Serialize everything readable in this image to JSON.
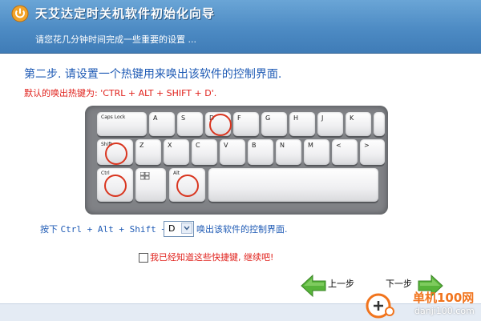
{
  "window": {
    "title": "天艾达定时关机软件初始化向导",
    "subtitle": "请您花几分钟时间完成一些重要的设置 ..."
  },
  "step": {
    "text": "第二步. 请设置一个热键用来唤出该软件的控制界面.",
    "default_hotkey": "默认的唤出热键为: 'CTRL + ALT + SHIFT + D'."
  },
  "keyboard": {
    "row1": [
      "Caps Lock",
      "A",
      "S",
      "D",
      "F",
      "G",
      "H",
      "J",
      "K"
    ],
    "row2": [
      "Shift",
      "Z",
      "X",
      "C",
      "V",
      "B",
      "N",
      "M",
      "<",
      ">"
    ],
    "row3": [
      "Ctrl",
      "",
      "Alt",
      ""
    ]
  },
  "combo": {
    "prefix": "按下 ",
    "ctrl": "Ctrl",
    "alt": "Alt",
    "shift": "Shift",
    "plus": " + ",
    "key_value": "D",
    "suffix": "唤出该软件的控制界面."
  },
  "confirm": {
    "label": "我已经知道这些快捷键, 继续吧!"
  },
  "nav": {
    "prev": "上一步",
    "next": "下一步"
  },
  "watermark": {
    "brand": "单机100网",
    "url": "danji100.com"
  },
  "colors": {
    "accent_blue": "#1f5bb5",
    "warning_red": "#e0211c",
    "arrow_green": "#57b43a"
  }
}
